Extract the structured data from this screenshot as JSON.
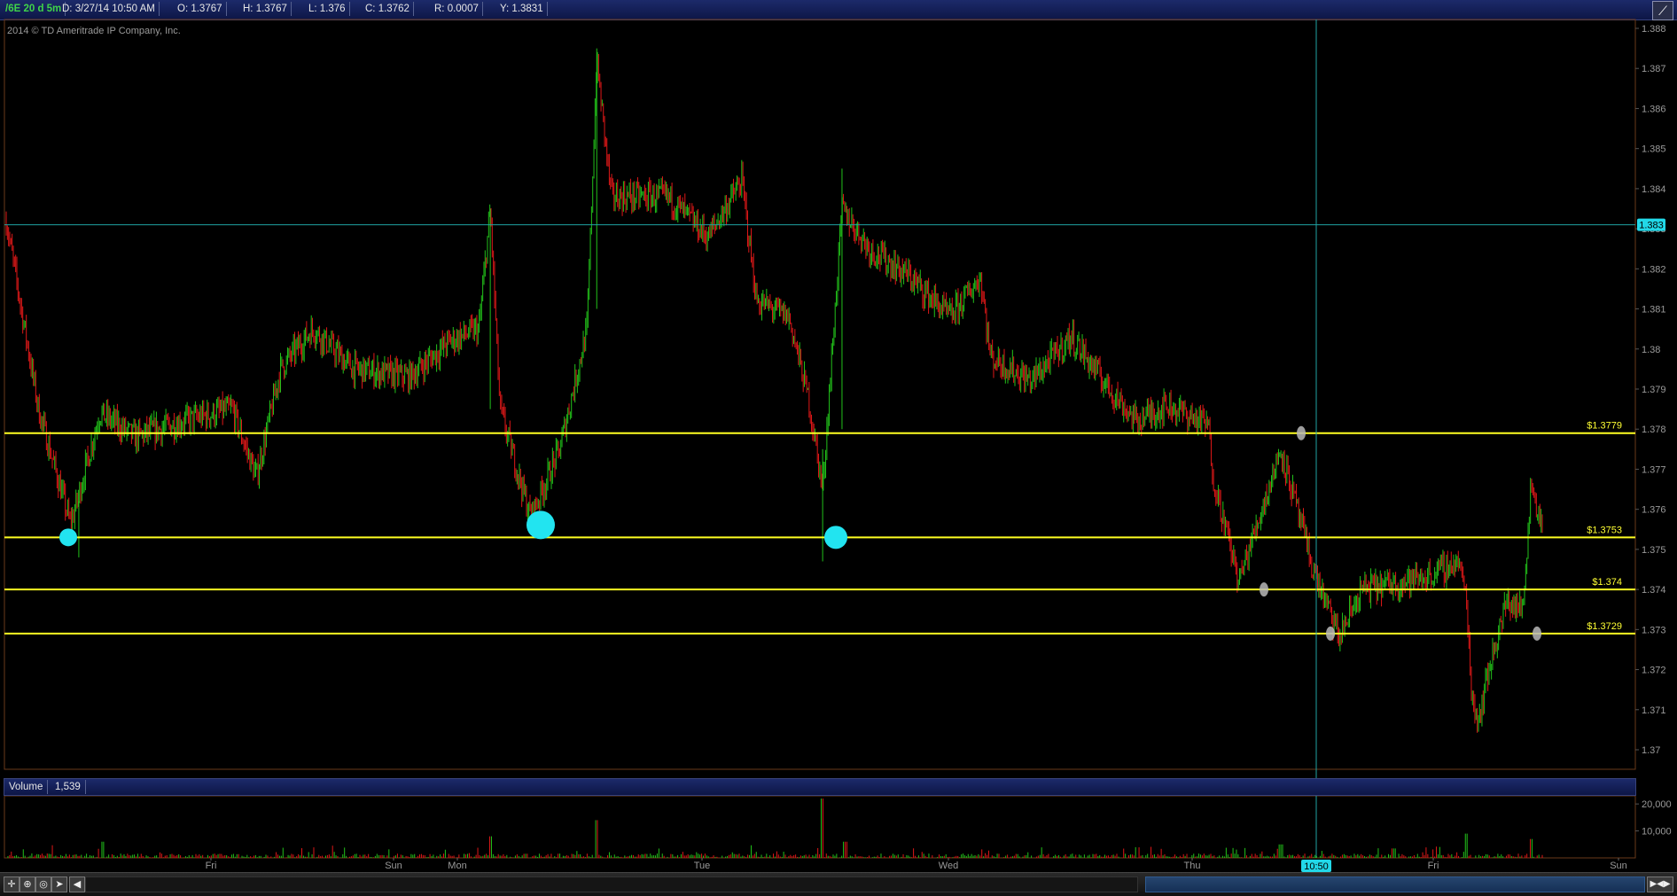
{
  "info_bar": {
    "symbol": "/6E 20 d 5m",
    "date": "D: 3/27/14 10:50 AM",
    "open": "O: 1.3767",
    "high": "H: 1.3767",
    "low": "L: 1.376",
    "close": "C: 1.3762",
    "range": "R: 0.0007",
    "y": "Y: 1.3831"
  },
  "copyright": "2014 © TD Ameritrade IP Company, Inc.",
  "colors": {
    "up": "#22c21a",
    "down": "#e01818",
    "level_line": "#ffff22",
    "crosshair": "#1fa3a3",
    "marker_cyan": "#22e4f0",
    "marker_grey": "#b8b8b8",
    "panel_border": "#6a3a1a",
    "badge": "#22d8e8"
  },
  "chart_data": [
    {
      "type": "candlestick",
      "title": "",
      "y_axis_ticks": [
        "1.388",
        "1.387",
        "1.386",
        "1.385",
        "1.384",
        "1.383",
        "1.382",
        "1.381",
        "1.38",
        "1.379",
        "1.378",
        "1.377",
        "1.376",
        "1.375",
        "1.374",
        "1.373",
        "1.372",
        "1.371",
        "1.37"
      ],
      "ylim": [
        1.37,
        1.388
      ],
      "x_axis_labels": [
        "Fri",
        "Sun",
        "Mon",
        "Tue",
        "Wed",
        "Thu",
        "Fri",
        "Sun"
      ],
      "crosshair": {
        "time_label": "10:50",
        "price_label": "1.383",
        "price": 1.3831
      },
      "horizontal_levels": [
        {
          "label": "$1.3779",
          "price": 1.3779
        },
        {
          "label": "$1.3753",
          "price": 1.3753
        },
        {
          "label": "$1.374",
          "price": 1.374
        },
        {
          "label": "$1.3729",
          "price": 1.3729
        }
      ],
      "price_path_keypoints": [
        {
          "t": 0.0,
          "p": 1.3832
        },
        {
          "t": 0.02,
          "p": 1.3785
        },
        {
          "t": 0.04,
          "p": 1.3756
        },
        {
          "t": 0.058,
          "p": 1.3784
        },
        {
          "t": 0.08,
          "p": 1.3778
        },
        {
          "t": 0.11,
          "p": 1.3782
        },
        {
          "t": 0.14,
          "p": 1.3785
        },
        {
          "t": 0.155,
          "p": 1.3768
        },
        {
          "t": 0.17,
          "p": 1.3795
        },
        {
          "t": 0.19,
          "p": 1.3805
        },
        {
          "t": 0.215,
          "p": 1.3795
        },
        {
          "t": 0.25,
          "p": 1.3793
        },
        {
          "t": 0.275,
          "p": 1.3802
        },
        {
          "t": 0.293,
          "p": 1.3805
        },
        {
          "t": 0.3,
          "p": 1.3835
        },
        {
          "t": 0.306,
          "p": 1.3785
        },
        {
          "t": 0.325,
          "p": 1.3758
        },
        {
          "t": 0.343,
          "p": 1.3775
        },
        {
          "t": 0.36,
          "p": 1.3805
        },
        {
          "t": 0.366,
          "p": 1.3872
        },
        {
          "t": 0.375,
          "p": 1.3838
        },
        {
          "t": 0.41,
          "p": 1.3838
        },
        {
          "t": 0.435,
          "p": 1.3828
        },
        {
          "t": 0.456,
          "p": 1.3842
        },
        {
          "t": 0.465,
          "p": 1.3812
        },
        {
          "t": 0.485,
          "p": 1.3808
        },
        {
          "t": 0.497,
          "p": 1.3788
        },
        {
          "t": 0.506,
          "p": 1.3765
        },
        {
          "t": 0.518,
          "p": 1.3835
        },
        {
          "t": 0.535,
          "p": 1.3825
        },
        {
          "t": 0.56,
          "p": 1.3818
        },
        {
          "t": 0.585,
          "p": 1.3808
        },
        {
          "t": 0.604,
          "p": 1.3818
        },
        {
          "t": 0.61,
          "p": 1.3798
        },
        {
          "t": 0.635,
          "p": 1.3792
        },
        {
          "t": 0.66,
          "p": 1.3803
        },
        {
          "t": 0.68,
          "p": 1.3792
        },
        {
          "t": 0.7,
          "p": 1.3782
        },
        {
          "t": 0.72,
          "p": 1.3786
        },
        {
          "t": 0.745,
          "p": 1.3781
        },
        {
          "t": 0.748,
          "p": 1.3768
        },
        {
          "t": 0.764,
          "p": 1.3742
        },
        {
          "t": 0.79,
          "p": 1.3775
        },
        {
          "t": 0.81,
          "p": 1.3745
        },
        {
          "t": 0.826,
          "p": 1.3728
        },
        {
          "t": 0.84,
          "p": 1.374
        },
        {
          "t": 0.88,
          "p": 1.3743
        },
        {
          "t": 0.9,
          "p": 1.3747
        },
        {
          "t": 0.905,
          "p": 1.3738
        },
        {
          "t": 0.908,
          "p": 1.3715
        },
        {
          "t": 0.912,
          "p": 1.3707
        },
        {
          "t": 0.92,
          "p": 1.3722
        },
        {
          "t": 0.93,
          "p": 1.3737
        },
        {
          "t": 0.94,
          "p": 1.3735
        },
        {
          "t": 0.945,
          "p": 1.3767
        },
        {
          "t": 0.952,
          "p": 1.3755
        }
      ]
    },
    {
      "type": "bar",
      "title": "Volume",
      "current_value": "1,539",
      "y_axis_ticks": [
        "20,000",
        "10,000"
      ],
      "ylim": [
        0,
        23000
      ]
    }
  ],
  "toolbar": {
    "crosshair_tool": "✛",
    "zoom_tool": "⊕",
    "magnifier_tool": "◎",
    "pointer_tool": "➤",
    "scroll_left": "◀",
    "scroll_right": "▶◀▶",
    "draw_tool": "⟋"
  }
}
